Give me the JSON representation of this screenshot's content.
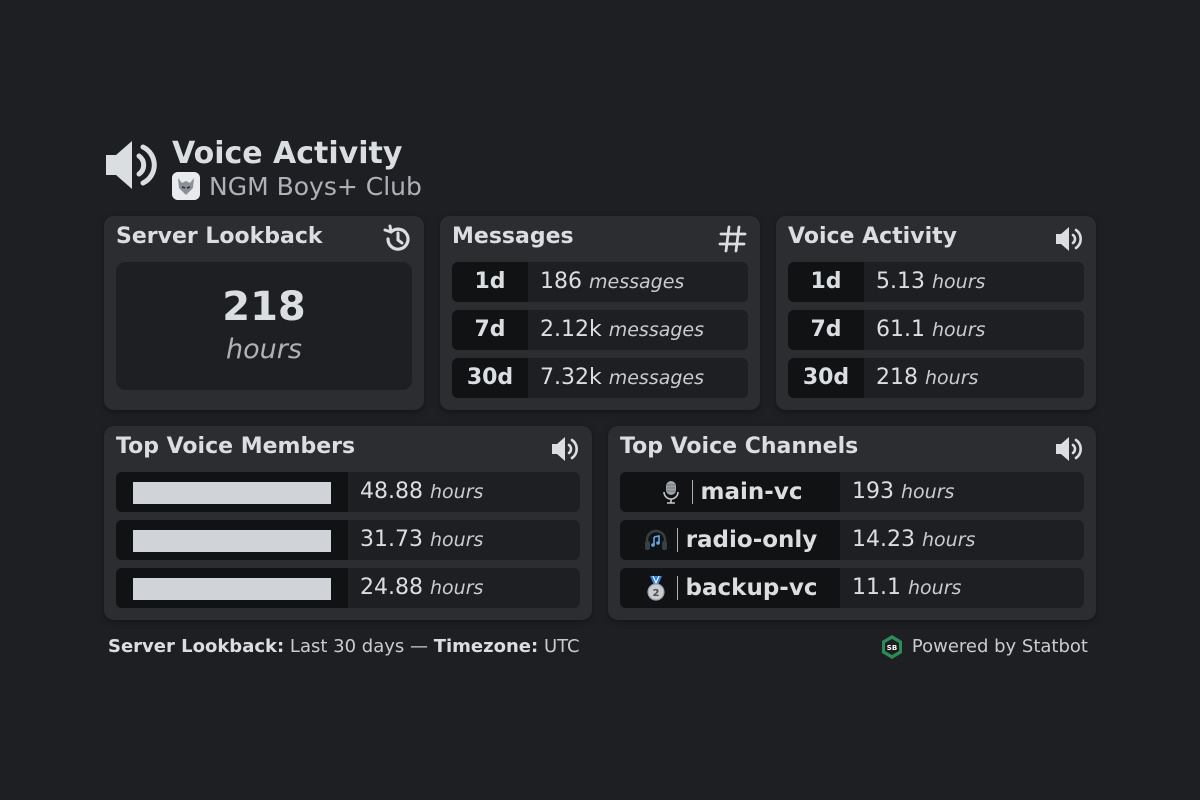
{
  "header": {
    "title": "Voice Activity",
    "server_name": "NGM Boys+ Club",
    "icon": "speaker-icon"
  },
  "server_lookback": {
    "title": "Server Lookback",
    "icon": "history-icon",
    "value": "218",
    "unit": "hours"
  },
  "messages": {
    "title": "Messages",
    "icon": "hash-icon",
    "rows": [
      {
        "period": "1d",
        "value": "186",
        "unit": "messages"
      },
      {
        "period": "7d",
        "value": "2.12k",
        "unit": "messages"
      },
      {
        "period": "30d",
        "value": "7.32k",
        "unit": "messages"
      }
    ]
  },
  "voice_activity": {
    "title": "Voice Activity",
    "icon": "speaker-icon",
    "rows": [
      {
        "period": "1d",
        "value": "5.13",
        "unit": "hours"
      },
      {
        "period": "7d",
        "value": "61.1",
        "unit": "hours"
      },
      {
        "period": "30d",
        "value": "218",
        "unit": "hours"
      }
    ]
  },
  "top_members": {
    "title": "Top Voice Members",
    "icon": "speaker-icon",
    "rows": [
      {
        "value": "48.88",
        "unit": "hours"
      },
      {
        "value": "31.73",
        "unit": "hours"
      },
      {
        "value": "24.88",
        "unit": "hours"
      }
    ]
  },
  "top_channels": {
    "title": "Top Voice Channels",
    "icon": "speaker-icon",
    "rows": [
      {
        "icon": "microphone-icon",
        "name": "main-vc",
        "value": "193",
        "unit": "hours"
      },
      {
        "icon": "headphones-icon",
        "name": "radio-only",
        "value": "14.23",
        "unit": "hours"
      },
      {
        "icon": "silver-medal-icon",
        "name": "backup-vc",
        "value": "11.1",
        "unit": "hours"
      }
    ]
  },
  "footer": {
    "lookback_label": "Server Lookback:",
    "lookback_value": "Last 30 days",
    "separator": "—",
    "timezone_label": "Timezone:",
    "timezone_value": "UTC",
    "powered_by": "Powered by Statbot",
    "logo_text": "SB"
  },
  "colors": {
    "background": "#1e1f22",
    "card": "#2b2d31",
    "row": "#1e1f22",
    "row_dark": "#111214",
    "text": "#dbdee1",
    "muted": "#aeb2b8",
    "statbot_green": "#2e8b57"
  }
}
